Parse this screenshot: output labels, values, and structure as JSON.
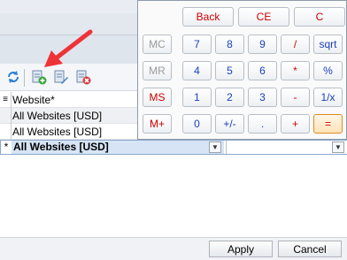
{
  "toolbar": {
    "icons": [
      "refresh-icon",
      "add-row-icon",
      "edit-row-icon",
      "delete-row-icon"
    ]
  },
  "grid": {
    "header": {
      "marker": "",
      "column": "Website*"
    },
    "rows": [
      "All Websites [USD]",
      "All Websites [USD]"
    ],
    "edit_row": {
      "marker": "*",
      "value": "All Websites [USD]",
      "second_value": ""
    }
  },
  "calculator": {
    "top_row": [
      "Back",
      "CE",
      "C"
    ],
    "memory": [
      "MC",
      "MR",
      "MS",
      "M+"
    ],
    "rows": [
      [
        "7",
        "8",
        "9",
        "/",
        "sqrt"
      ],
      [
        "4",
        "5",
        "6",
        "*",
        "%"
      ],
      [
        "1",
        "2",
        "3",
        "-",
        "1/x"
      ],
      [
        "0",
        "+/-",
        ".",
        "+",
        "="
      ]
    ]
  },
  "dialog": {
    "apply_label": "Apply",
    "cancel_label": "Cancel"
  },
  "colors": {
    "annotation_arrow": "#ee3338",
    "selected_row": "#d6e4f5",
    "memory_disabled": "#9a9a9a",
    "operator": "#cc0000",
    "digit": "#1a3fbf"
  }
}
